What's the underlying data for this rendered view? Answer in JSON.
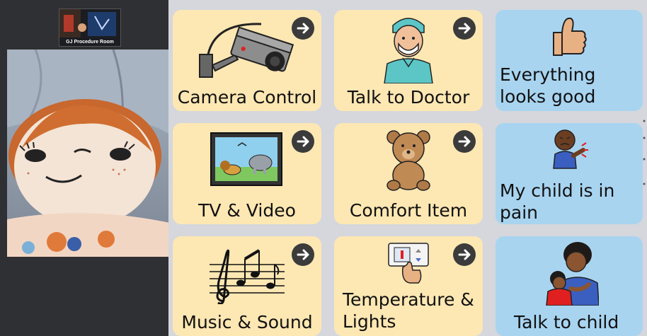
{
  "video": {
    "thumb_label": "GJ Procedure Room"
  },
  "tiles": [
    {
      "label": "Camera Control",
      "icon": "camera-icon",
      "kind": "folder"
    },
    {
      "label": "Talk to Doctor",
      "icon": "doctor-icon",
      "kind": "folder"
    },
    {
      "label": "Everything looks good",
      "icon": "thumbs-up-icon",
      "kind": "message"
    },
    {
      "label": "TV & Video",
      "icon": "tv-icon",
      "kind": "folder"
    },
    {
      "label": "Comfort Item",
      "icon": "teddy-bear-icon",
      "kind": "folder"
    },
    {
      "label": "My child is in pain",
      "icon": "pain-icon",
      "kind": "message"
    },
    {
      "label": "Music & Sound",
      "icon": "music-notes-icon",
      "kind": "folder"
    },
    {
      "label": "Temperature & Lights",
      "icon": "thermostat-icon",
      "kind": "folder"
    },
    {
      "label": "Talk to child",
      "icon": "parent-hug-icon",
      "kind": "message"
    }
  ],
  "colors": {
    "folder_tile": "#fde7b3",
    "message_tile": "#a8d4f0",
    "grid_background": "#d5d7dc"
  }
}
